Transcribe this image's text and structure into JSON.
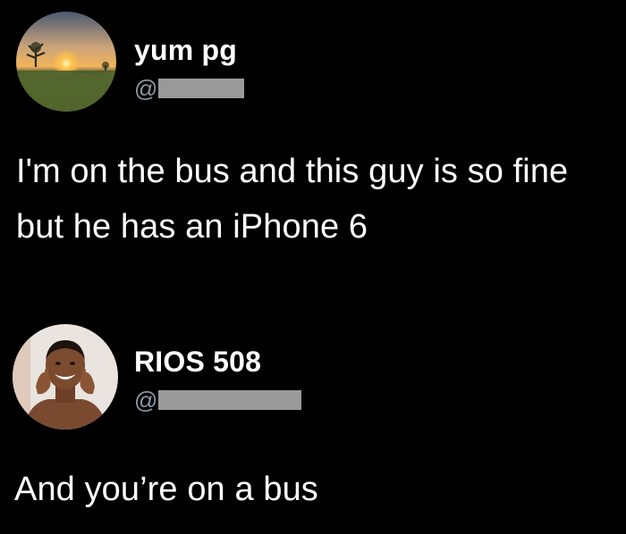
{
  "tweets": [
    {
      "display_name": "yum pg",
      "handle_prefix": "@",
      "handle_redacted": true,
      "avatar_icon": "sunset-landscape-avatar",
      "text": "I'm on the bus and this guy is so fine but he has an iPhone 6"
    },
    {
      "display_name": "RIOS 508",
      "handle_prefix": "@",
      "handle_redacted": true,
      "avatar_icon": "smiling-man-avatar",
      "text": "And you’re on a bus"
    }
  ],
  "colors": {
    "background": "#000000",
    "text": "#ffffff",
    "handle": "#8b98a5",
    "redaction": "#9a9a9a"
  }
}
